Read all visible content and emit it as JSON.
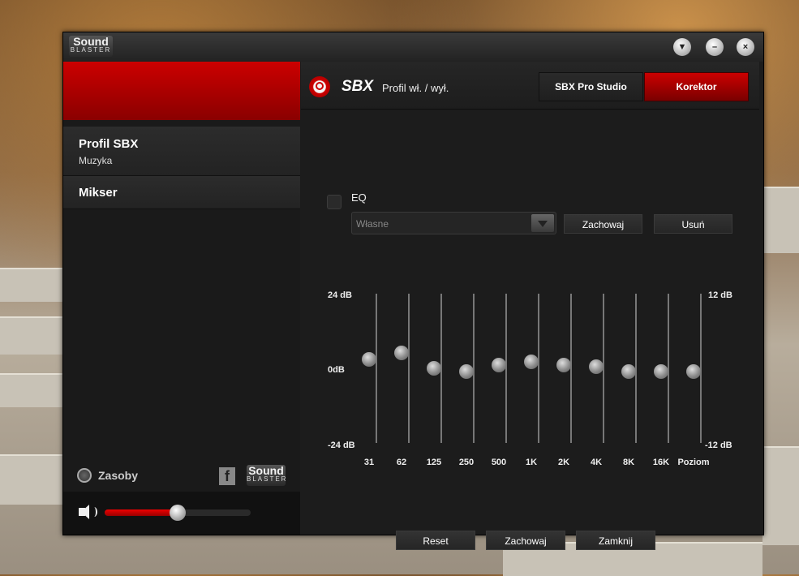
{
  "window": {
    "logo_top": "Sound",
    "logo_bottom": "BLASTER",
    "buttons": [
      "▼",
      "–",
      "×"
    ]
  },
  "sidebar": {
    "items": [
      {
        "title": "Profil SBX",
        "subtitle": "Muzyka"
      },
      {
        "title": "Mikser",
        "subtitle": ""
      }
    ],
    "resources_label": "Zasoby",
    "facebook_label": "f",
    "volume_level": 0.5
  },
  "header": {
    "brand": "SBX",
    "profile_toggle": "Profil wł. / wył.",
    "tabs": [
      "SBX Pro Studio",
      "Korektor"
    ],
    "active_tab": "Korektor"
  },
  "eq": {
    "checkbox_label": "EQ",
    "preset_value": "Własne",
    "save_label": "Zachowaj",
    "delete_label": "Usuń",
    "left_scale": [
      "24 dB",
      "0dB",
      "-24 dB"
    ],
    "right_scale": [
      "12 dB",
      "-12 dB"
    ],
    "bands": [
      {
        "label": "31",
        "db": 3
      },
      {
        "label": "62",
        "db": 5
      },
      {
        "label": "125",
        "db": 0
      },
      {
        "label": "250",
        "db": -1
      },
      {
        "label": "500",
        "db": 1
      },
      {
        "label": "1K",
        "db": 2
      },
      {
        "label": "2K",
        "db": 1
      },
      {
        "label": "4K",
        "db": 0.5
      },
      {
        "label": "8K",
        "db": -1
      },
      {
        "label": "16K",
        "db": -1
      }
    ],
    "level": {
      "label": "Poziom",
      "db": -0.5
    }
  },
  "footer": {
    "reset_label": "Reset",
    "save_label": "Zachowaj",
    "close_label": "Zamknij"
  },
  "colors": {
    "accent_red": "#c00000",
    "dark_bg": "#1c1c1c"
  }
}
